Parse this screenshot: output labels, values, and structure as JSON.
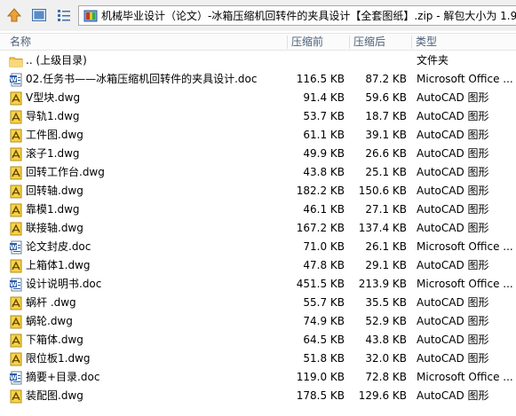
{
  "address": {
    "path": "机械毕业设计（论文）-冰箱压缩机回转件的夹具设计【全套图纸】.zip - 解包大小为 1.9"
  },
  "columns": {
    "name": "名称",
    "size": "压缩前",
    "csize": "压缩后",
    "type": "类型"
  },
  "rows": [
    {
      "icon": "folder-up",
      "name": ".. (上级目录)",
      "size": "",
      "csize": "",
      "type": "文件夹"
    },
    {
      "icon": "doc",
      "name": "02.任务书——冰箱压缩机回转件的夹具设计.doc",
      "size": "116.5 KB",
      "csize": "87.2 KB",
      "type": "Microsoft Office ..."
    },
    {
      "icon": "dwg",
      "name": "V型块.dwg",
      "size": "91.4 KB",
      "csize": "59.6 KB",
      "type": "AutoCAD 图形"
    },
    {
      "icon": "dwg",
      "name": "导轨1.dwg",
      "size": "53.7 KB",
      "csize": "18.7 KB",
      "type": "AutoCAD 图形"
    },
    {
      "icon": "dwg",
      "name": "工件图.dwg",
      "size": "61.1 KB",
      "csize": "39.1 KB",
      "type": "AutoCAD 图形"
    },
    {
      "icon": "dwg",
      "name": "滚子1.dwg",
      "size": "49.9 KB",
      "csize": "26.6 KB",
      "type": "AutoCAD 图形"
    },
    {
      "icon": "dwg",
      "name": "回转工作台.dwg",
      "size": "43.8 KB",
      "csize": "25.1 KB",
      "type": "AutoCAD 图形"
    },
    {
      "icon": "dwg",
      "name": "回转轴.dwg",
      "size": "182.2 KB",
      "csize": "150.6 KB",
      "type": "AutoCAD 图形"
    },
    {
      "icon": "dwg",
      "name": "靠模1.dwg",
      "size": "46.1 KB",
      "csize": "27.1 KB",
      "type": "AutoCAD 图形"
    },
    {
      "icon": "dwg",
      "name": "联接轴.dwg",
      "size": "167.2 KB",
      "csize": "137.4 KB",
      "type": "AutoCAD 图形"
    },
    {
      "icon": "doc",
      "name": "论文封皮.doc",
      "size": "71.0 KB",
      "csize": "26.1 KB",
      "type": "Microsoft Office ..."
    },
    {
      "icon": "dwg",
      "name": "上箱体1.dwg",
      "size": "47.8 KB",
      "csize": "29.1 KB",
      "type": "AutoCAD 图形"
    },
    {
      "icon": "doc",
      "name": "设计说明书.doc",
      "size": "451.5 KB",
      "csize": "213.9 KB",
      "type": "Microsoft Office ..."
    },
    {
      "icon": "dwg",
      "name": "蜗杆 .dwg",
      "size": "55.7 KB",
      "csize": "35.5 KB",
      "type": "AutoCAD 图形"
    },
    {
      "icon": "dwg",
      "name": "蜗轮.dwg",
      "size": "74.9 KB",
      "csize": "52.9 KB",
      "type": "AutoCAD 图形"
    },
    {
      "icon": "dwg",
      "name": "下箱体.dwg",
      "size": "64.5 KB",
      "csize": "43.8 KB",
      "type": "AutoCAD 图形"
    },
    {
      "icon": "dwg",
      "name": "限位板1.dwg",
      "size": "51.8 KB",
      "csize": "32.0 KB",
      "type": "AutoCAD 图形"
    },
    {
      "icon": "doc",
      "name": "摘要+目录.doc",
      "size": "119.0 KB",
      "csize": "72.8 KB",
      "type": "Microsoft Office ..."
    },
    {
      "icon": "dwg",
      "name": "装配图.dwg",
      "size": "178.5 KB",
      "csize": "129.6 KB",
      "type": "AutoCAD 图形"
    }
  ]
}
